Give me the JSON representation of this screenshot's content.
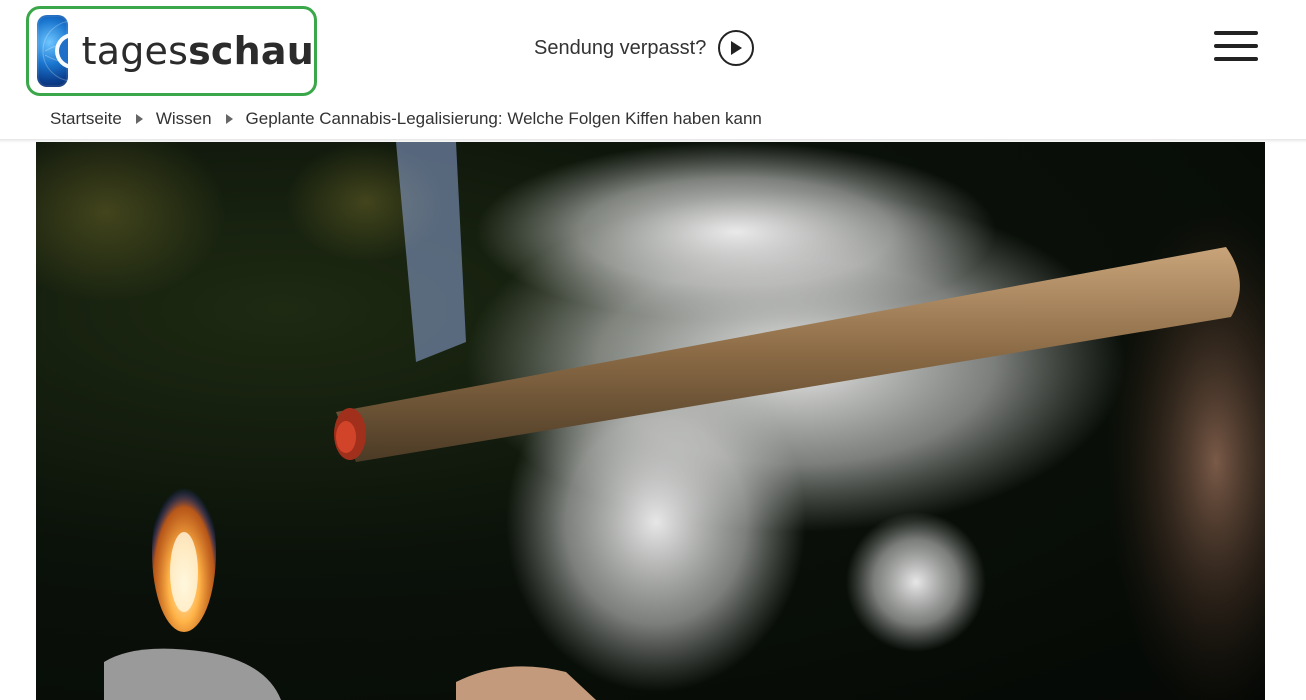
{
  "header": {
    "logo": {
      "text_light": "tages",
      "text_bold": "schau",
      "icon": "ard-1-logo-icon"
    },
    "sendung_label": "Sendung verpasst?",
    "sendung_icon": "play-circle-icon",
    "menu_icon": "hamburger-menu-icon"
  },
  "breadcrumb": {
    "items": [
      {
        "label": "Startseite"
      },
      {
        "label": "Wissen"
      },
      {
        "label": "Geplante Cannabis-Legalisierung: Welche Folgen Kiffen haben kann"
      }
    ]
  },
  "hero": {
    "subject": "joint-and-lighter-photo"
  },
  "colors": {
    "logo_border": "#3aa84a",
    "logo_blue": "#1a76cf",
    "text": "#333333"
  }
}
